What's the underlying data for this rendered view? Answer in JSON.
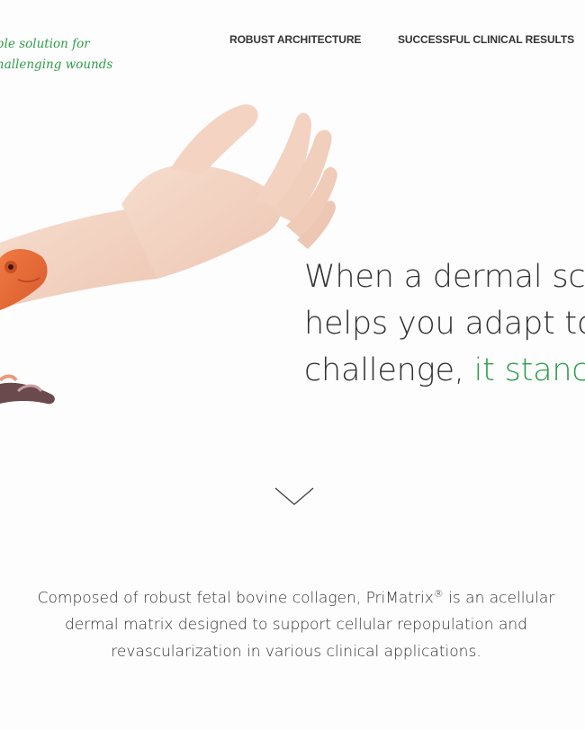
{
  "tagline": {
    "line1": "ble solution for",
    "line2": "hallenging wounds"
  },
  "nav": {
    "items": [
      {
        "label": "ROBUST ARCHITECTURE"
      },
      {
        "label": "SUCCESSFUL CLINICAL RESULTS"
      }
    ]
  },
  "hero": {
    "headline_line1": "When a dermal sca",
    "headline_line2": "helps you adapt to",
    "headline_line3_prefix": "challenge, ",
    "headline_line3_highlight": "it stanc",
    "image_subject": "hand-with-chameleon-illustration"
  },
  "scroll_icon": "chevron-down-icon",
  "intro": {
    "part1": "Composed of robust fetal bovine collagen, PriMatrix",
    "reg_mark": "®",
    "part2": " is an acellular dermal matrix designed to support cellular repopulation and revascularization in various clinical applications."
  },
  "colors": {
    "accent": "#2e9d4a",
    "text": "#333333",
    "background": "#fdfdfd",
    "chameleon": "#e4693a",
    "skin": "#f3d5c5"
  }
}
